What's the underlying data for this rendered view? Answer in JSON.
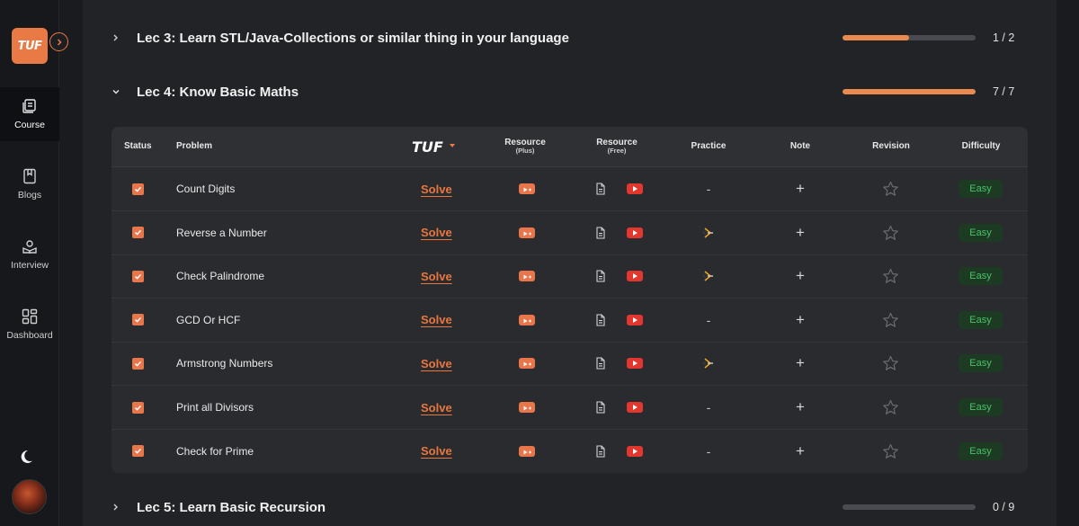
{
  "sidebar": {
    "logo_text": "TUF",
    "items": [
      {
        "label": "Course",
        "icon": "course-icon",
        "active": true
      },
      {
        "label": "Blogs",
        "icon": "blog-icon",
        "active": false
      },
      {
        "label": "Interview",
        "icon": "interview-icon",
        "active": false
      },
      {
        "label": "Dashboard",
        "icon": "dashboard-icon",
        "active": false
      }
    ]
  },
  "lectures": [
    {
      "title": "Lec 3: Learn STL/Java-Collections or similar thing in your language",
      "progress_count": "1 / 2",
      "progress": 0.5,
      "expanded": false
    },
    {
      "title": "Lec 4: Know Basic Maths",
      "progress_count": "7 / 7",
      "progress": 1.0,
      "expanded": true
    },
    {
      "title": "Lec 5: Learn Basic Recursion",
      "progress_count": "0 / 9",
      "progress": 0.0,
      "expanded": false
    }
  ],
  "table": {
    "headers": {
      "status": "Status",
      "problem": "Problem",
      "tuf": "TUF",
      "resource_plus": "Resource",
      "resource_plus_sub": "(Plus)",
      "resource_free": "Resource",
      "resource_free_sub": "(Free)",
      "practice": "Practice",
      "note": "Note",
      "revision": "Revision",
      "difficulty": "Difficulty"
    },
    "solve_label": "Solve",
    "dash": "-",
    "plus": "+",
    "rows": [
      {
        "problem": "Count Digits",
        "practice": "dash",
        "difficulty": "Easy",
        "checked": true
      },
      {
        "problem": "Reverse a Number",
        "practice": "codestudio-icon",
        "difficulty": "Easy",
        "checked": true
      },
      {
        "problem": "Check Palindrome",
        "practice": "codestudio-icon",
        "difficulty": "Easy",
        "checked": true
      },
      {
        "problem": "GCD Or HCF",
        "practice": "dash",
        "difficulty": "Easy",
        "checked": true
      },
      {
        "problem": "Armstrong Numbers",
        "practice": "codestudio-icon",
        "difficulty": "Easy",
        "checked": true
      },
      {
        "problem": "Print all Divisors",
        "practice": "dash",
        "difficulty": "Easy",
        "checked": true
      },
      {
        "problem": "Check for Prime",
        "practice": "dash",
        "difficulty": "Easy",
        "checked": true
      }
    ]
  },
  "colors": {
    "accent": "#ea7a45",
    "progress": "#ea8a4e",
    "easy_text": "#47c36a",
    "easy_bg": "#1d3a22",
    "youtube": "#e2372f"
  }
}
